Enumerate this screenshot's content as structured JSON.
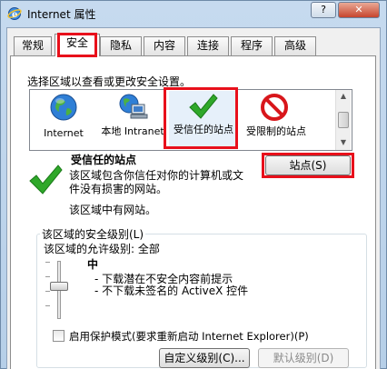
{
  "window": {
    "title": "Internet 属性",
    "help_label": "?",
    "close_label": "✕"
  },
  "tabs": [
    {
      "label": "常规"
    },
    {
      "label": "安全"
    },
    {
      "label": "隐私"
    },
    {
      "label": "内容"
    },
    {
      "label": "连接"
    },
    {
      "label": "程序"
    },
    {
      "label": "高级"
    }
  ],
  "active_tab": "安全",
  "security": {
    "select_zone_prompt": "选择区域以查看或更改安全设置。",
    "zones": [
      {
        "label": "Internet",
        "icon": "globe-icon"
      },
      {
        "label": "本地 Intranet",
        "icon": "local-intranet-icon"
      },
      {
        "label": "受信任的站点",
        "icon": "green-check-icon"
      },
      {
        "label": "受限制的站点",
        "icon": "prohibited-icon"
      }
    ],
    "selected_zone": "受信任的站点",
    "zone_title": "受信任的站点",
    "zone_description": "该区域包含你信任对你的计算机或文件没有损害的网站。",
    "zone_sites_note": "该区域中有网站。",
    "sites_button": "站点(S)",
    "level_group_title": "该区域的安全级别(L)",
    "allowed_levels": "该区域的允许级别: 全部",
    "level_name": "中",
    "level_bullets": [
      "下载潜在不安全内容前提示",
      "不下载未签名的 ActiveX 控件"
    ],
    "slider_level": 0.5,
    "protected_mode_label": "启用保护模式(要求重新启动 Internet Explorer)(P)",
    "protected_mode_checked": false,
    "custom_level_button": "自定义级别(C)...",
    "default_level_button": "默认级别(D)"
  },
  "colors": {
    "highlight_box": "#e8101b",
    "check_green": "#2fa82a",
    "prohibited_red": "#d8161b"
  }
}
